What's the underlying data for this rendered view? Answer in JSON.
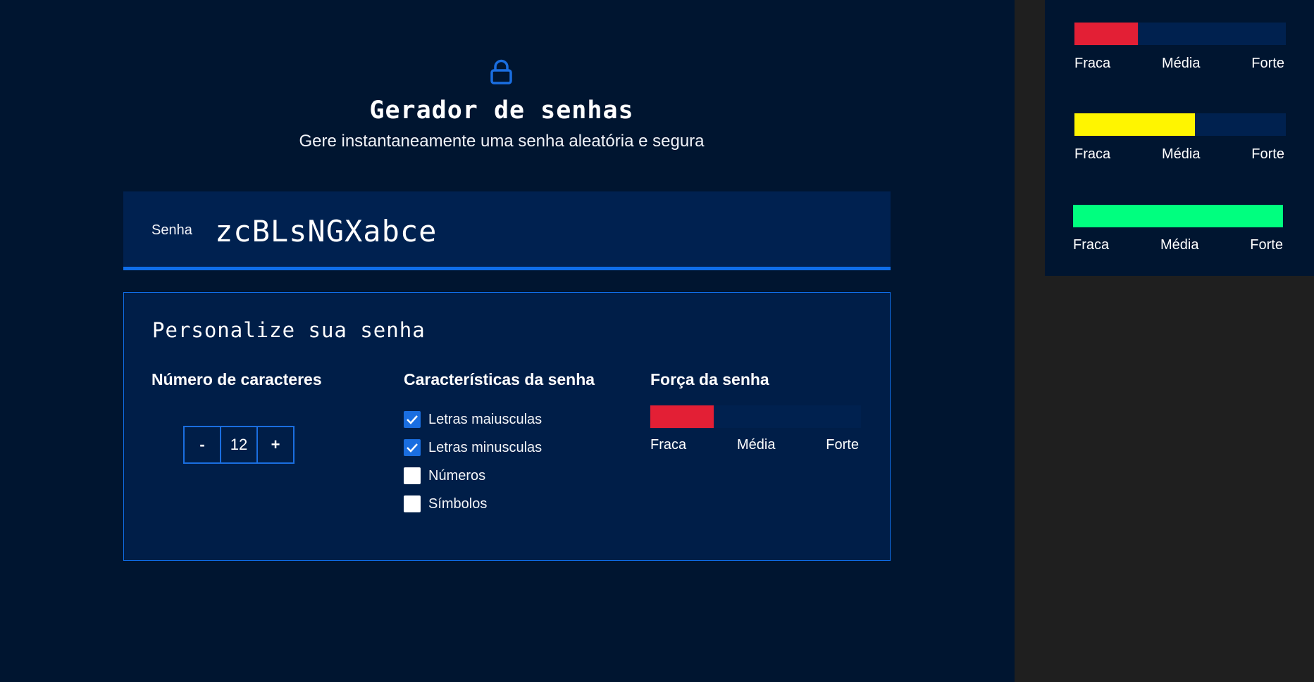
{
  "header": {
    "title": "Gerador de senhas",
    "subtitle": "Gere instantaneamente uma senha aleatória e segura",
    "icon": "lock-icon"
  },
  "password": {
    "label": "Senha",
    "value": "zcBLsNGXabce"
  },
  "customize": {
    "title": "Personalize sua senha",
    "length": {
      "heading": "Número de caracteres",
      "decrement": "-",
      "value": "12",
      "increment": "+"
    },
    "features": {
      "heading": "Características da senha",
      "options": [
        {
          "label": "Letras maiusculas",
          "checked": true
        },
        {
          "label": "Letras minusculas",
          "checked": true
        },
        {
          "label": "Números",
          "checked": false
        },
        {
          "label": "Símbolos",
          "checked": false
        }
      ]
    },
    "strength": {
      "heading": "Força da senha",
      "level": 0.3,
      "color": "#e31f35",
      "labels": [
        "Fraca",
        "Média",
        "Forte"
      ]
    }
  },
  "strength_examples": [
    {
      "level": 0.3,
      "color": "#e31f35",
      "labels": [
        "Fraca",
        "Média",
        "Forte"
      ]
    },
    {
      "level": 0.57,
      "color": "#fff500",
      "labels": [
        "Fraca",
        "Média",
        "Forte"
      ]
    },
    {
      "level": 1.0,
      "color": "#00ff7f",
      "labels": [
        "Fraca",
        "Média",
        "Forte"
      ]
    }
  ],
  "colors": {
    "background": "#001530",
    "panel": "#001e48",
    "accent": "#0f6ee9",
    "track": "#00214f"
  }
}
